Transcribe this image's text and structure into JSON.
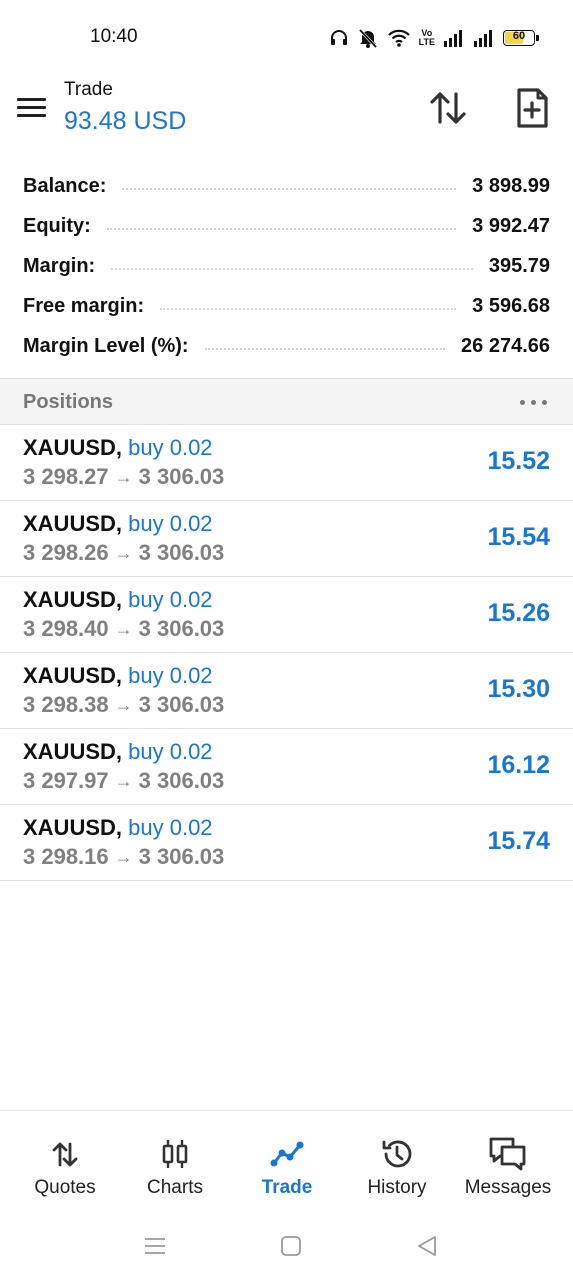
{
  "status_bar": {
    "time": "10:40",
    "network_label_top": "Vo",
    "network_label_bottom": "LTE",
    "battery": "60"
  },
  "header": {
    "title": "Trade",
    "profit": "93.48 USD",
    "accent_color": "#1976d2"
  },
  "summary": [
    {
      "label": "Balance:",
      "value": "3 898.99"
    },
    {
      "label": "Equity:",
      "value": "3 992.47"
    },
    {
      "label": "Margin:",
      "value": "395.79"
    },
    {
      "label": "Free margin:",
      "value": "3 596.68"
    },
    {
      "label": "Margin Level (%):",
      "value": "26 274.66"
    }
  ],
  "positions": {
    "title": "Positions",
    "arrow": "→",
    "items": [
      {
        "symbol": "XAUUSD,",
        "type": "buy 0.02",
        "open_price": "3 298.27",
        "current_price": "3 306.03",
        "profit": "15.52"
      },
      {
        "symbol": "XAUUSD,",
        "type": "buy 0.02",
        "open_price": "3 298.26",
        "current_price": "3 306.03",
        "profit": "15.54"
      },
      {
        "symbol": "XAUUSD,",
        "type": "buy 0.02",
        "open_price": "3 298.40",
        "current_price": "3 306.03",
        "profit": "15.26"
      },
      {
        "symbol": "XAUUSD,",
        "type": "buy 0.02",
        "open_price": "3 298.38",
        "current_price": "3 306.03",
        "profit": "15.30"
      },
      {
        "symbol": "XAUUSD,",
        "type": "buy 0.02",
        "open_price": "3 297.97",
        "current_price": "3 306.03",
        "profit": "16.12"
      },
      {
        "symbol": "XAUUSD,",
        "type": "buy 0.02",
        "open_price": "3 298.16",
        "current_price": "3 306.03",
        "profit": "15.74"
      }
    ]
  },
  "bottom_nav": [
    {
      "label": "Quotes",
      "icon": "quotes-icon"
    },
    {
      "label": "Charts",
      "icon": "charts-icon"
    },
    {
      "label": "Trade",
      "icon": "trade-icon",
      "active": true
    },
    {
      "label": "History",
      "icon": "history-icon"
    },
    {
      "label": "Messages",
      "icon": "messages-icon"
    }
  ]
}
